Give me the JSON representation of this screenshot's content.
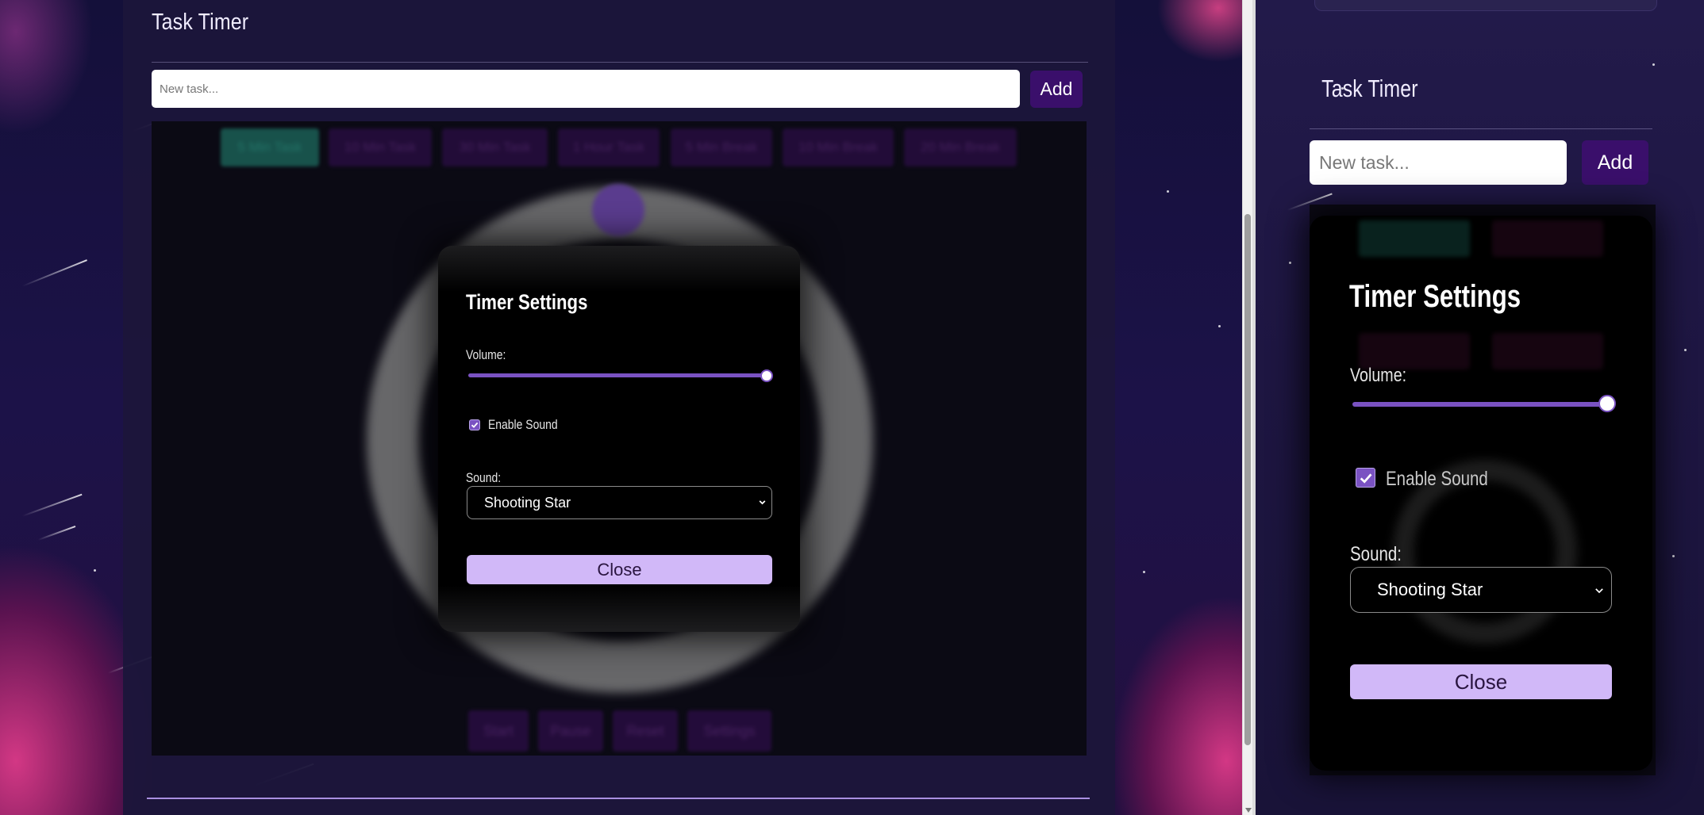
{
  "app": {
    "title": "Task Timer",
    "new_task_placeholder": "New task...",
    "add_label": "Add"
  },
  "presets": [
    "5 Min Task",
    "10 Min Task",
    "30 Min Task",
    "1 Hour Task",
    "5 Min Break",
    "10 Min Break",
    "20 Min Break"
  ],
  "controls": [
    "Start",
    "Pause",
    "Reset",
    "Settings"
  ],
  "settings_dialog": {
    "title": "Timer Settings",
    "volume_label": "Volume:",
    "volume_value": 1.0,
    "enable_sound_label": "Enable Sound",
    "enable_sound_checked": true,
    "sound_label": "Sound:",
    "sound_selected": "Shooting Star",
    "close_label": "Close"
  },
  "colors": {
    "accent": "#7a52c2",
    "add_button": "#3a0f6b",
    "close_button": "#d1b8f8",
    "active_preset": "#1d6a5e"
  }
}
